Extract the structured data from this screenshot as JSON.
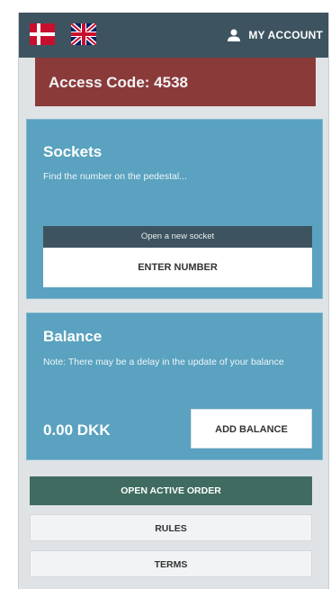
{
  "header": {
    "flags": [
      "denmark-flag-icon",
      "uk-flag-icon"
    ],
    "account_label": "MY ACCOUNT",
    "account_icon": "person-icon"
  },
  "access": {
    "label": "Access Code: 4538"
  },
  "sockets": {
    "title": "Sockets",
    "hint": "Find the number on the pedestal...",
    "open_new_label": "Open a new socket",
    "enter_number_label": "ENTER NUMBER"
  },
  "balance": {
    "title": "Balance",
    "note": "Note: There may be a delay in the update of your balance",
    "amount": "0.00 DKK",
    "add_label": "ADD BALANCE"
  },
  "actions": {
    "open_active_order": "OPEN ACTIVE ORDER",
    "rules": "RULES",
    "terms": "TERMS"
  },
  "colors": {
    "header_bg": "#3d5460",
    "access_bg": "#8b3a3a",
    "card_bg": "#5aa2bf",
    "primary_button": "#3f6b60"
  }
}
